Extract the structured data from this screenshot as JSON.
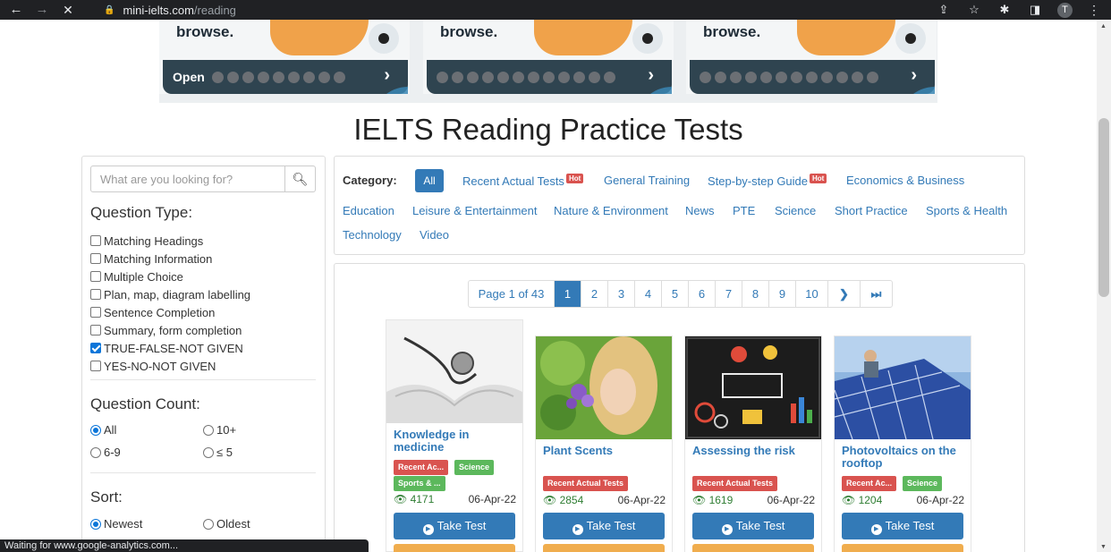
{
  "browser": {
    "domain": "mini-ielts.com",
    "path": "/reading",
    "avatar_letter": "T",
    "status_text": "Waiting for www.google-analytics.com..."
  },
  "ads": [
    {
      "headline": "browse.",
      "open_label": "Open"
    },
    {
      "headline": "browse.",
      "open_label": ""
    },
    {
      "headline": "browse.",
      "open_label": ""
    }
  ],
  "page_title": "IELTS Reading Practice Tests",
  "sidebar": {
    "search_placeholder": "What are you looking for?",
    "question_type_title": "Question Type:",
    "question_types": [
      {
        "label": "Matching Headings",
        "checked": false
      },
      {
        "label": "Matching Information",
        "checked": false
      },
      {
        "label": "Multiple Choice",
        "checked": false
      },
      {
        "label": "Plan, map, diagram labelling",
        "checked": false
      },
      {
        "label": "Sentence Completion",
        "checked": false
      },
      {
        "label": "Summary, form completion",
        "checked": false
      },
      {
        "label": "TRUE-FALSE-NOT GIVEN",
        "checked": true
      },
      {
        "label": "YES-NO-NOT GIVEN",
        "checked": false
      }
    ],
    "question_count_title": "Question Count:",
    "question_counts": [
      {
        "label": "All",
        "checked": true
      },
      {
        "label": "10+",
        "checked": false
      },
      {
        "label": "6-9",
        "checked": false
      },
      {
        "label": "≤ 5",
        "checked": false
      }
    ],
    "sort_title": "Sort:",
    "sort_options": [
      {
        "label": "Newest",
        "checked": true
      },
      {
        "label": "Oldest",
        "checked": false
      }
    ]
  },
  "category": {
    "label": "Category:",
    "all_label": "All",
    "hot_label": "Hot",
    "links": [
      "Recent Actual Tests",
      "General Training",
      "Step-by-step Guide",
      "Economics & Business",
      "Education",
      "Leisure & Entertainment",
      "Nature & Environment",
      "News",
      "PTE",
      "Science",
      "Short Practice",
      "Sports & Health",
      "Technology",
      "Video"
    ]
  },
  "pagination": {
    "info": "Page 1 of 43",
    "pages": [
      "1",
      "2",
      "3",
      "4",
      "5",
      "6",
      "7",
      "8",
      "9",
      "10"
    ],
    "current": "1",
    "next_icon": "chevron-right",
    "last_icon": "skip-to-end"
  },
  "cards": [
    {
      "title": "Knowledge in medicine",
      "tags": [
        "Recent Ac...",
        "Science",
        "Sports & ..."
      ],
      "views": "4171",
      "date": "06-Apr-22",
      "button": "Take Test"
    },
    {
      "title": "Plant Scents",
      "tags": [
        "Recent Actual Tests"
      ],
      "views": "2854",
      "date": "06-Apr-22",
      "button": "Take Test"
    },
    {
      "title": "Assessing the risk",
      "tags": [
        "Recent Actual Tests"
      ],
      "views": "1619",
      "date": "06-Apr-22",
      "button": "Take Test"
    },
    {
      "title": "Photovoltaics on the rooftop",
      "tags": [
        "Recent Ac...",
        "Science"
      ],
      "views": "1204",
      "date": "06-Apr-22",
      "button": "Take Test"
    }
  ],
  "colors": {
    "accent": "#337ab7",
    "tag_red": "#d9534f",
    "tag_green": "#5cb85c",
    "secondary_button": "#f0ad4e"
  }
}
